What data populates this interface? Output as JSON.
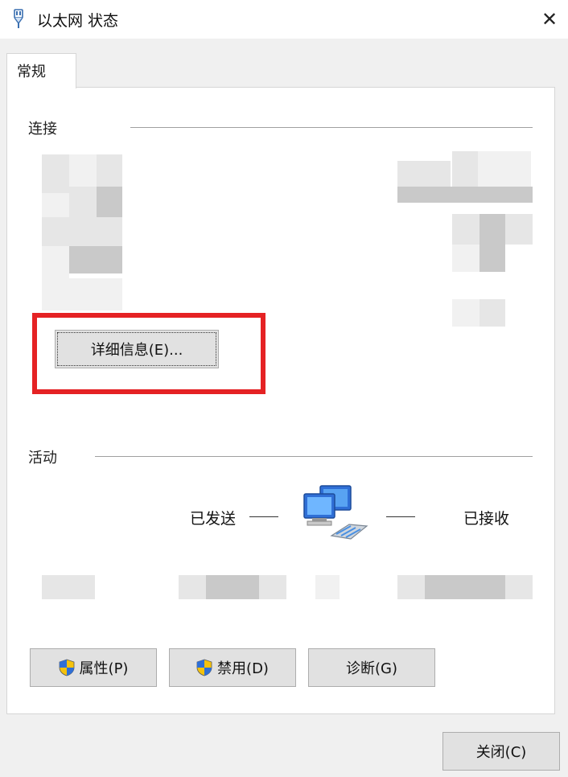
{
  "window": {
    "title": "以太网 状态",
    "close_glyph": "✕"
  },
  "tabs": [
    {
      "label": "常规",
      "selected": true
    }
  ],
  "connection": {
    "group_label": "连接",
    "details_button": "详细信息(E)..."
  },
  "activity": {
    "group_label": "活动",
    "sent_label": "已发送",
    "received_label": "已接收",
    "dash": "——"
  },
  "buttons": {
    "properties": "属性(P)",
    "disable": "禁用(D)",
    "diagnose": "诊断(G)",
    "close": "关闭(C)"
  },
  "icons": {
    "title": "network-adapter-icon",
    "activity": "network-computers-icon",
    "shield": "uac-shield-icon"
  },
  "colors": {
    "highlight_box": "#e52224",
    "button_face": "#e1e1e1",
    "panel_bg": "#ffffff",
    "window_bg": "#f0f0f0"
  }
}
